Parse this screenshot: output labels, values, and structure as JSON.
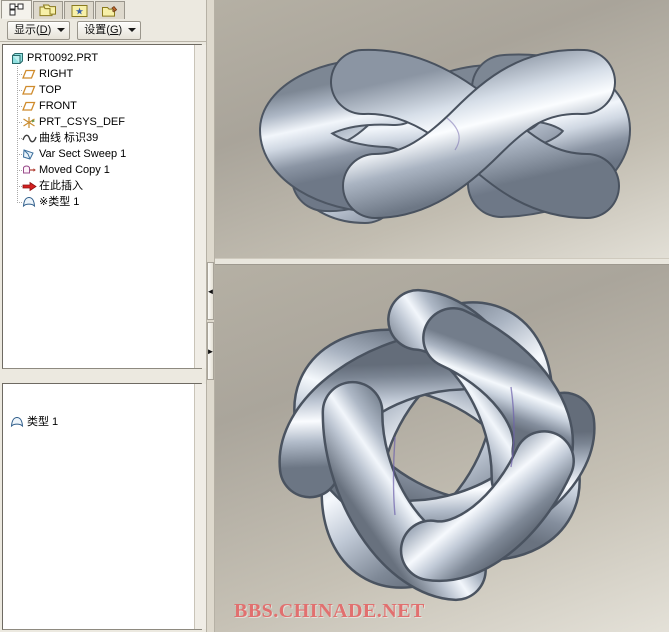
{
  "app": {
    "title": "PRT0092.PRT",
    "watermark": "BBS.CHINADE.NET"
  },
  "tabs": [
    {
      "name": "model-tree-tab",
      "icon": "model-tree-icon",
      "label": "",
      "active": true
    },
    {
      "name": "folder-browser-tab",
      "icon": "folder-stack-icon",
      "label": "",
      "active": false
    },
    {
      "name": "favorites-tab",
      "icon": "star-window-icon",
      "label": "",
      "active": false
    },
    {
      "name": "connections-tab",
      "icon": "folder-plug-icon",
      "label": "",
      "active": false
    }
  ],
  "toolbar": {
    "show_button": {
      "text": "显示",
      "mnemonic": "D",
      "open": "(",
      "close": ")"
    },
    "settings_button": {
      "text": "设置",
      "mnemonic": "G",
      "open": "(",
      "close": ")"
    }
  },
  "tree": {
    "items": [
      {
        "label": "PRT0092.PRT",
        "icon": "part-cube-icon",
        "level": 0
      },
      {
        "label": "RIGHT",
        "icon": "datum-plane-icon",
        "level": 1
      },
      {
        "label": "TOP",
        "icon": "datum-plane-icon",
        "level": 1
      },
      {
        "label": "FRONT",
        "icon": "datum-plane-icon",
        "level": 1
      },
      {
        "label": "PRT_CSYS_DEF",
        "icon": "coord-system-icon",
        "level": 1
      },
      {
        "label": "曲线 标识39",
        "icon": "curve-icon",
        "level": 1
      },
      {
        "label": "Var Sect Sweep 1",
        "icon": "sweep-icon",
        "level": 1
      },
      {
        "label": "Moved Copy 1",
        "icon": "moved-copy-icon",
        "level": 1
      },
      {
        "label": "在此插入",
        "icon": "insert-here-icon",
        "level": 1
      },
      {
        "label": "※类型 1",
        "icon": "surface-icon",
        "level": 1
      }
    ]
  },
  "detail": {
    "items": [
      {
        "label": "类型 1",
        "icon": "surface-icon"
      }
    ]
  },
  "splitter": {
    "collapse_left_glyph": "◄",
    "collapse_right_glyph": "►"
  },
  "viewports": [
    {
      "name": "viewport-top",
      "model": "braided-knot-flat",
      "background_top": "#b5b0a4",
      "background_bottom": "#e2dfd6"
    },
    {
      "name": "viewport-bottom",
      "model": "woven-ring-knot",
      "background_top": "#b5b0a4",
      "background_bottom": "#e4e1d8"
    }
  ],
  "colors": {
    "model_light": "#e8edf4",
    "model_mid": "#a7b2c0",
    "model_dark": "#6b7585",
    "model_edge": "#4b5563",
    "panel_bg": "#ece9e0",
    "tree_bg": "#ffffff",
    "watermark": "#e1706f",
    "accent_part_icon": "#7fd8d8",
    "accent_datum_icon": "#d98b2b",
    "insert_arrow": "#d02020"
  }
}
